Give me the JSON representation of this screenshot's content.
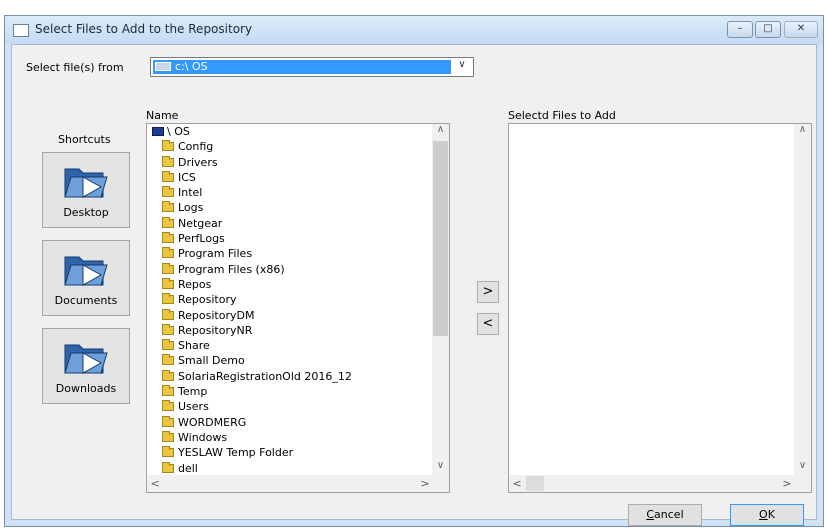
{
  "window": {
    "title": "Select Files to Add to the Repository",
    "controls": {
      "minimize": "–",
      "maximize": "□",
      "close": "✕"
    }
  },
  "from": {
    "label": "Select file(s) from",
    "value": "c:\\ OS",
    "arrow": "∨"
  },
  "shortcuts": {
    "label": "Shortcuts",
    "items": [
      "Desktop",
      "Documents",
      "Downloads"
    ]
  },
  "name_list": {
    "header": "Name",
    "root": "\\ OS",
    "folders": [
      "Config",
      "Drivers",
      "ICS",
      "Intel",
      "Logs",
      "Netgear",
      "PerfLogs",
      "Program Files",
      "Program Files (x86)",
      "Repos",
      "Repository",
      "RepositoryDM",
      "RepositoryNR",
      "Share",
      "Small Demo",
      "SolariaRegistrationOld 2016_12",
      "Temp",
      "Users",
      "WORDMERG",
      "Windows",
      "YESLAW Temp Folder",
      "dell"
    ]
  },
  "selected_list": {
    "header": "Selectd Files to Add"
  },
  "move_buttons": {
    "add": ">",
    "remove": "<"
  },
  "buttons": {
    "cancel": "Cancel",
    "ok": "OK"
  },
  "scroll_glyphs": {
    "up": "∧",
    "down": "∨",
    "left": "<",
    "right": ">"
  },
  "colors": {
    "selection": "#3399ff",
    "folder": "#e9c541",
    "shortcut_folder": "#2f63a8"
  },
  "icons": {
    "shortcut": "folder-icon",
    "root": "floppy-disk-icon"
  }
}
